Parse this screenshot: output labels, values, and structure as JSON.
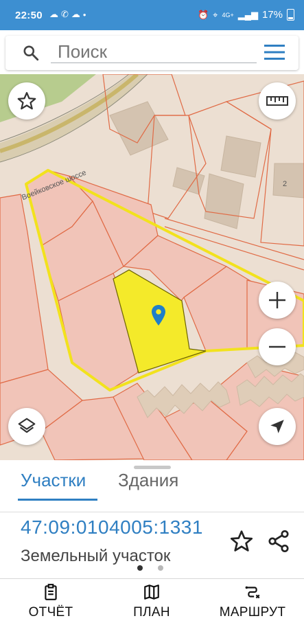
{
  "status_bar": {
    "time": "22:50",
    "left_icons": [
      "cloud-icon",
      "whatsapp-icon",
      "cloud-outline-icon",
      "dot-icon"
    ],
    "network": "4G+",
    "battery": "17%"
  },
  "search": {
    "placeholder": "Поиск"
  },
  "map": {
    "road_label": "Воейковское шоссе",
    "house_number": "2",
    "colors": {
      "background": "#ecdfd2",
      "parcel_fill": "#f1c4b8",
      "parcel_border": "#e06a45",
      "selection_border": "#f2e21d",
      "selected_parcel": "#f4ea2a",
      "pin": "#1f7fc8"
    }
  },
  "sheet": {
    "tabs": [
      {
        "label": "Участки",
        "active": true
      },
      {
        "label": "Здания",
        "active": false
      }
    ],
    "parcel_number": "47:09:0104005:1331",
    "parcel_type": "Земельный участок"
  },
  "bottom_nav": {
    "items": [
      {
        "label": "ОТЧЁТ",
        "icon": "report-icon"
      },
      {
        "label": "ПЛАН",
        "icon": "map-plan-icon"
      },
      {
        "label": "МАРШРУТ",
        "icon": "route-icon"
      }
    ]
  },
  "accent_color": "#2f7fc2",
  "status_bar_color": "#3d8fd1"
}
